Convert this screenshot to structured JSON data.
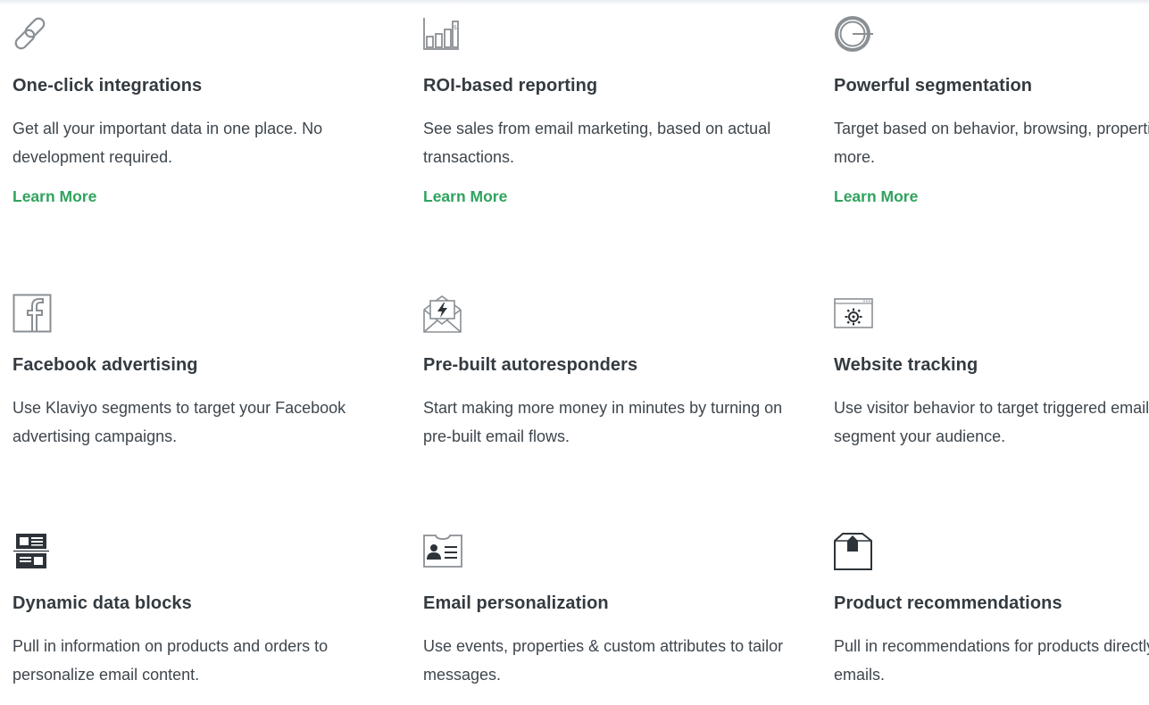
{
  "features": [
    {
      "icon": "chain-link-icon",
      "title": "One-click integrations",
      "desc": "Get all your important data in one place. No development required.",
      "link": "Learn More"
    },
    {
      "icon": "bar-chart-dollar-icon",
      "title": "ROI-based reporting",
      "desc": "See sales from email marketing, based on actual transactions.",
      "link": "Learn More"
    },
    {
      "icon": "target-circle-icon",
      "title": "Powerful segmentation",
      "desc": "Target based on behavior, browsing, properties & more.",
      "link": "Learn More"
    },
    {
      "icon": "facebook-icon",
      "title": "Facebook advertising",
      "desc": "Use Klaviyo segments to target your Facebook advertising campaigns."
    },
    {
      "icon": "envelope-lightning-icon",
      "title": "Pre-built autoresponders",
      "desc": "Start making more money in minutes by turning on pre-built email flows."
    },
    {
      "icon": "browser-gear-icon",
      "title": "Website tracking",
      "desc": "Use visitor behavior to target triggered emails and segment your audience."
    },
    {
      "icon": "data-blocks-icon",
      "title": "Dynamic data blocks",
      "desc": "Pull in information on products and orders to personalize email content."
    },
    {
      "icon": "id-card-icon",
      "title": "Email personalization",
      "desc": "Use events, properties & custom attributes to tailor messages."
    },
    {
      "icon": "product-box-icon",
      "title": "Product recommendations",
      "desc": "Pull in recommendations for products directly into emails."
    }
  ],
  "colors": {
    "link": "#2fa35e",
    "title": "#333a40",
    "text": "#3e464d",
    "icon_light": "#8a8f94",
    "icon_dark": "#2d3339"
  }
}
